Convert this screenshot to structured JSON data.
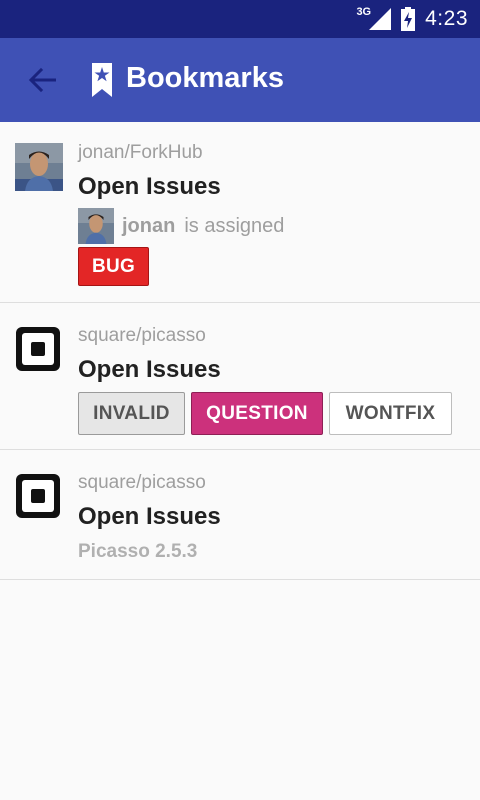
{
  "status_bar": {
    "network": "3G",
    "time": "4:23"
  },
  "app_bar": {
    "title": "Bookmarks"
  },
  "items": [
    {
      "repo": "jonan/ForkHub",
      "title": "Open Issues",
      "assignee": "jonan",
      "assigned_text": "is assigned",
      "labels": [
        {
          "name": "BUG",
          "bg": "#e32626",
          "fg": "#ffffff",
          "border": "#a51414"
        }
      ]
    },
    {
      "repo": "square/picasso",
      "title": "Open Issues",
      "labels": [
        {
          "name": "INVALID",
          "bg": "#e6e6e6",
          "fg": "#555555",
          "border": "#9a9a9a"
        },
        {
          "name": "QUESTION",
          "bg": "#cc317c",
          "fg": "#ffffff",
          "border": "#8e1f55"
        },
        {
          "name": "WONTFIX",
          "bg": "#ffffff",
          "fg": "#555555",
          "border": "#bdbdbd"
        }
      ]
    },
    {
      "repo": "square/picasso",
      "title": "Open Issues",
      "milestone": "Picasso 2.5.3"
    }
  ],
  "colors": {
    "status_bar": "#1a237e",
    "app_bar": "#3f51b5",
    "background": "#fafafa"
  },
  "icons": {
    "back": "arrow-back-icon",
    "bookmark": "bookmark-icon",
    "square_logo": "square-logo-icon"
  }
}
